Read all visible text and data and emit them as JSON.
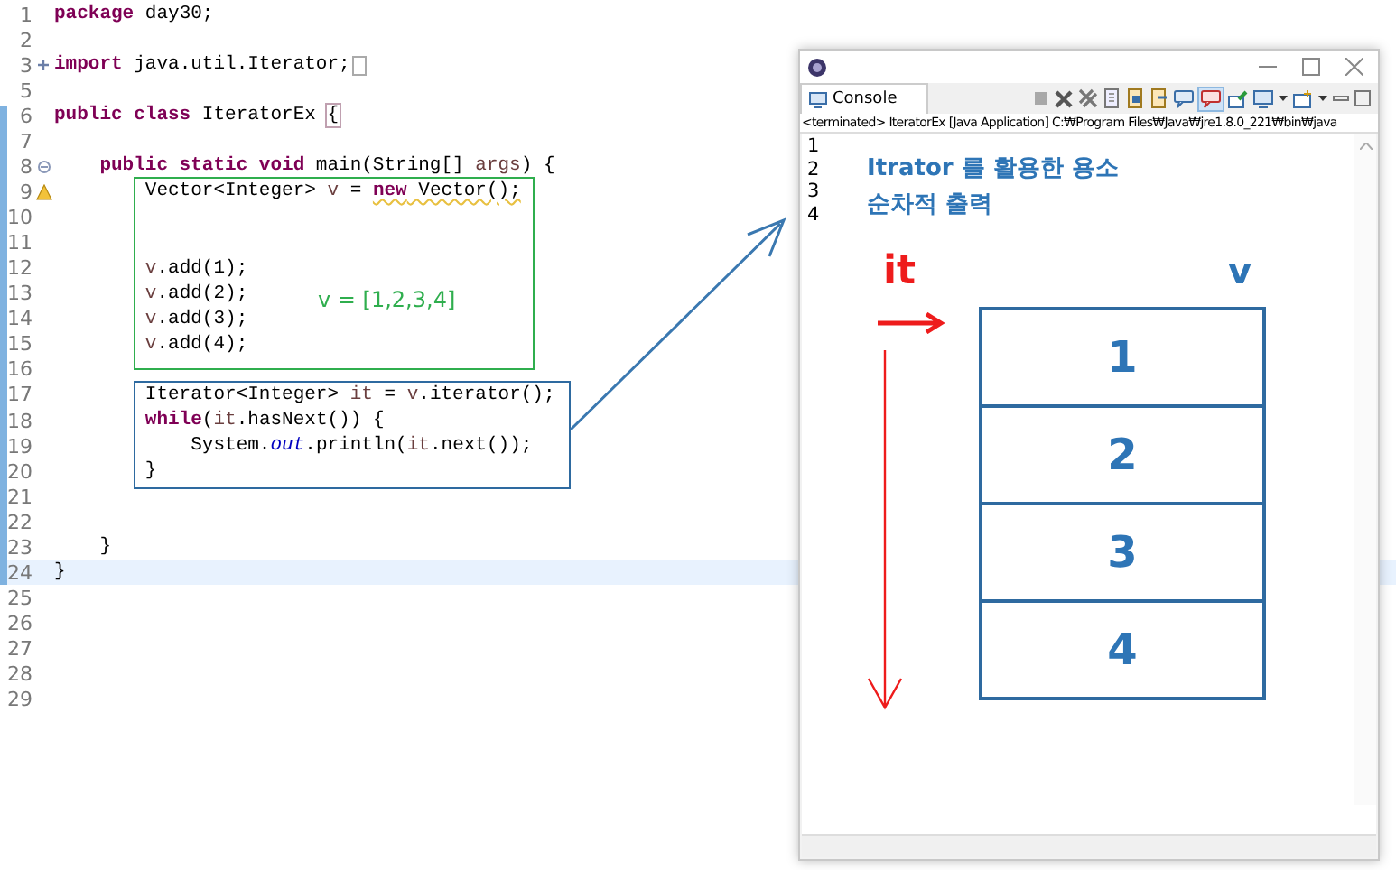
{
  "editor": {
    "lines": [
      {
        "number": "1",
        "kind": "plain",
        "current": false,
        "tokens": [
          {
            "text": "package",
            "kind": "keyword"
          },
          {
            "text": " day30;",
            "kind": "plain"
          }
        ]
      },
      {
        "number": "2",
        "kind": "plain",
        "current": false
      },
      {
        "number": "3",
        "kind": "foldable",
        "expanded": false,
        "current": false,
        "tokens": [
          {
            "text": "import",
            "kind": "keyword"
          },
          {
            "text": " java.util.Iterator;",
            "kind": "plain"
          }
        ]
      },
      {
        "number": "5",
        "kind": "plain",
        "current": false
      },
      {
        "number": "6",
        "kind": "plain",
        "current": false,
        "tokens": [
          {
            "text": "public class",
            "kind": "keyword"
          },
          {
            "text": " IteratorEx ",
            "kind": "plain"
          },
          {
            "text": "{",
            "kind": "match"
          }
        ]
      },
      {
        "number": "7",
        "kind": "plain",
        "current": false
      },
      {
        "number": "8",
        "kind": "foldable",
        "expanded": true,
        "current": false,
        "tokens": [
          {
            "text": "    public static void",
            "kind": "keyword"
          },
          {
            "text": " main(String[] ",
            "kind": "plain"
          },
          {
            "text": "args",
            "kind": "param"
          },
          {
            "text": ") {",
            "kind": "plain"
          }
        ]
      },
      {
        "number": "9",
        "kind": "warning",
        "current": false,
        "tokens": [
          {
            "text": "        Vector<Integer> ",
            "kind": "plain"
          },
          {
            "text": "v",
            "kind": "local"
          },
          {
            "text": " = ",
            "kind": "plain"
          },
          {
            "text": "new",
            "kind": "keyword-warn"
          },
          {
            "text": " Vector();",
            "kind": "warn"
          }
        ]
      },
      {
        "number": "10",
        "kind": "plain",
        "current": false
      },
      {
        "number": "11",
        "kind": "plain",
        "current": false
      },
      {
        "number": "12",
        "kind": "plain",
        "current": false,
        "tokens": [
          {
            "text": "        v",
            "kind": "local"
          },
          {
            "text": ".add(1);",
            "kind": "plain"
          }
        ]
      },
      {
        "number": "13",
        "kind": "plain",
        "current": false,
        "tokens": [
          {
            "text": "        v",
            "kind": "local"
          },
          {
            "text": ".add(2);",
            "kind": "plain"
          }
        ]
      },
      {
        "number": "14",
        "kind": "plain",
        "current": false,
        "tokens": [
          {
            "text": "        v",
            "kind": "local"
          },
          {
            "text": ".add(3);",
            "kind": "plain"
          }
        ]
      },
      {
        "number": "15",
        "kind": "plain",
        "current": false,
        "tokens": [
          {
            "text": "        v",
            "kind": "local"
          },
          {
            "text": ".add(4);",
            "kind": "plain"
          }
        ]
      },
      {
        "number": "16",
        "kind": "plain",
        "current": false
      },
      {
        "number": "17",
        "kind": "plain",
        "current": false,
        "tokens": [
          {
            "text": "        Iterator<Integer> ",
            "kind": "plain"
          },
          {
            "text": "it",
            "kind": "local"
          },
          {
            "text": " = ",
            "kind": "plain"
          },
          {
            "text": "v",
            "kind": "local"
          },
          {
            "text": ".iterator();",
            "kind": "plain"
          }
        ]
      },
      {
        "number": "18",
        "kind": "plain",
        "current": false,
        "tokens": [
          {
            "text": "        while",
            "kind": "keyword"
          },
          {
            "text": "(",
            "kind": "plain"
          },
          {
            "text": "it",
            "kind": "local"
          },
          {
            "text": ".hasNext()) {",
            "kind": "plain"
          }
        ]
      },
      {
        "number": "19",
        "kind": "plain",
        "current": false,
        "tokens": [
          {
            "text": "            System.",
            "kind": "plain"
          },
          {
            "text": "out",
            "kind": "field"
          },
          {
            "text": ".println(",
            "kind": "plain"
          },
          {
            "text": "it",
            "kind": "local"
          },
          {
            "text": ".next());",
            "kind": "plain"
          }
        ]
      },
      {
        "number": "20",
        "kind": "plain",
        "current": false,
        "tokens": [
          {
            "text": "        }",
            "kind": "plain"
          }
        ]
      },
      {
        "number": "21",
        "kind": "plain",
        "current": false
      },
      {
        "number": "22",
        "kind": "plain",
        "current": false
      },
      {
        "number": "23",
        "kind": "plain",
        "current": false,
        "tokens": [
          {
            "text": "    }",
            "kind": "plain"
          }
        ]
      },
      {
        "number": "24",
        "kind": "plain",
        "current": true,
        "tokens": [
          {
            "text": "}",
            "kind": "plain"
          }
        ]
      },
      {
        "number": "25",
        "kind": "plain",
        "current": false
      },
      {
        "number": "26",
        "kind": "plain",
        "current": false
      },
      {
        "number": "27",
        "kind": "plain",
        "current": false
      },
      {
        "number": "28",
        "kind": "plain",
        "current": false
      },
      {
        "number": "29",
        "kind": "plain",
        "current": false
      }
    ]
  },
  "annotation": {
    "vector_note": "v = [1,2,3,4]"
  },
  "console": {
    "tab": "Console",
    "status": "<terminated> IteratorEx [Java Application] C:₩Program Files₩Java₩jre1.8.0_221₩bin₩java",
    "output": [
      "1",
      "2",
      "3",
      "4"
    ],
    "notes": [
      "Itrator 를 활용한 용소",
      "순차적 출력"
    ],
    "diagram": {
      "pointer_label": "it",
      "vector_label": "v",
      "cells": [
        "1",
        "2",
        "3",
        "4"
      ]
    }
  }
}
